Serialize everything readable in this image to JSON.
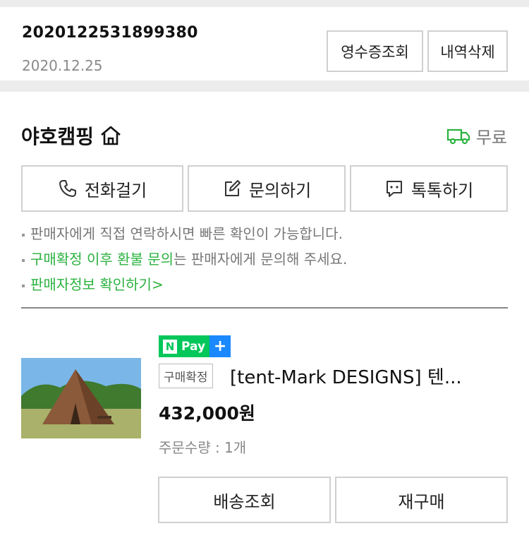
{
  "order": {
    "number": "2020122531899380",
    "date": "2020.12.25",
    "receipt_label": "영수증조회",
    "delete_label": "내역삭제"
  },
  "seller": {
    "name": "야호캠핑",
    "shipping": "무료",
    "call_label": "전화걸기",
    "inquiry_label": "문의하기",
    "talk_label": "톡톡하기",
    "note1": "판매자에게 직접 연락하시면 빠른 확인이 가능합니다.",
    "note2_highlight": "구매확정 이후 환불 문의",
    "note2_rest": "는 판매자에게 문의해 주세요.",
    "note3_link": "판매자정보 확인하기",
    "note3_arrow": ">"
  },
  "product": {
    "npay_label": "Pay",
    "npay_n": "N",
    "npay_plus": "+",
    "status": "구매확정",
    "name": "[tent-Mark DESIGNS] 텐...",
    "price": "432,000원",
    "quantity": "주문수량 : 1개",
    "track_label": "배송조회",
    "reorder_label": "재구매"
  },
  "colors": {
    "green": "#2ab23f",
    "npay_green": "#03c75a",
    "npay_blue": "#1a88ff"
  }
}
